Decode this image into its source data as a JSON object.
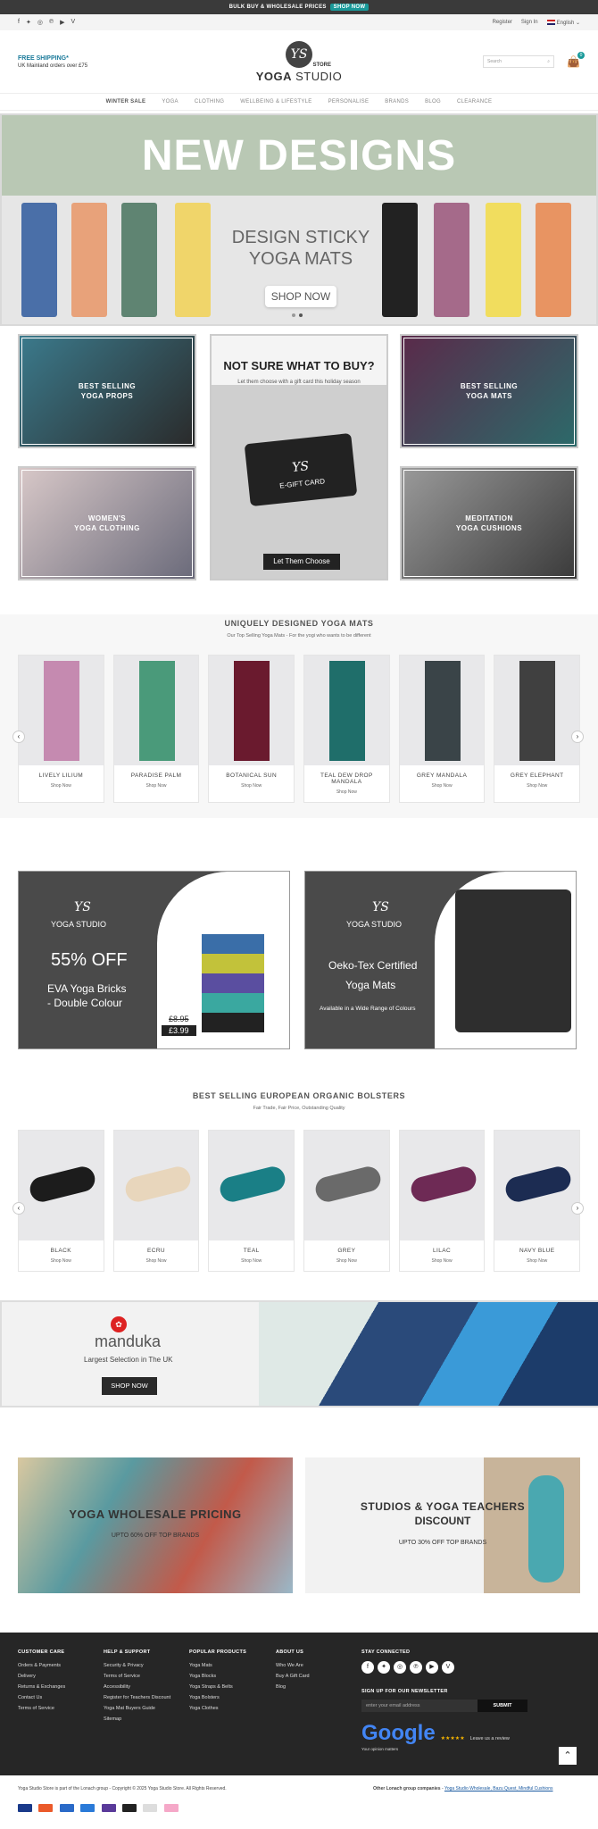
{
  "topbar": {
    "text": "BULK BUY & WHOLESALE PRICES",
    "button": "SHOP NOW"
  },
  "util": {
    "register": "Register",
    "signin": "Sign In",
    "language": "English"
  },
  "header": {
    "freeship_title": "FREE SHIPPING*",
    "freeship_text": "UK Mainland orders over £75",
    "logo_initials": "YS",
    "logo_name": "YOGA",
    "logo_name2": "STUDIO",
    "logo_store": "STORE",
    "search_placeholder": "Search",
    "cart_count": "0"
  },
  "nav": [
    "WINTER SALE",
    "YOGA",
    "CLOTHING",
    "WELLBEING & LIFESTYLE",
    "PERSONALISE",
    "BRANDS",
    "BLOG",
    "CLEARANCE"
  ],
  "hero": {
    "title": "NEW DESIGNS",
    "line1": "DESIGN STICKY",
    "line2": "YOGA MATS",
    "button": "SHOP NOW"
  },
  "tiles": {
    "props": "BEST SELLING\nYOGA PROPS",
    "mats": "BEST SELLING\nYOGA MATS",
    "clothing": "WOMEN'S\nYOGA CLOTHING",
    "cushions": "MEDITATION\nYOGA CUSHIONS"
  },
  "gift": {
    "title": "NOT SURE WHAT TO BUY?",
    "text": "Let them choose with a gift card this holiday season",
    "card_label": "E-GIFT CARD",
    "button": "Let Them Choose"
  },
  "mats_section": {
    "title": "UNIQUELY DESIGNED YOGA MATS",
    "subtitle": "Our Top Selling Yoga Mats - For the yogi who wants to be different",
    "items": [
      {
        "name": "LIVELY LILIUM",
        "shop": "Shop Now",
        "color": "#c58ab0"
      },
      {
        "name": "PARADISE PALM",
        "shop": "Shop Now",
        "color": "#4a9a7a"
      },
      {
        "name": "BOTANICAL SUN",
        "shop": "Shop Now",
        "color": "#6a1a2e"
      },
      {
        "name": "TEAL DEW DROP MANDALA",
        "shop": "Shop Now",
        "color": "#1f6e6a"
      },
      {
        "name": "GREY MANDALA",
        "shop": "Shop Now",
        "color": "#3a4448"
      },
      {
        "name": "GREY ELEPHANT",
        "shop": "Shop Now",
        "color": "#404040"
      }
    ]
  },
  "promo1": {
    "brand": "YOGA STUDIO",
    "headline": "55% OFF",
    "line1": "EVA Yoga Bricks",
    "line2": "- Double Colour",
    "old_price": "£8.95",
    "new_price": "£3.99"
  },
  "promo2": {
    "brand": "YOGA STUDIO",
    "line1": "Oeko-Tex Certified",
    "line2": "Yoga Mats",
    "line3": "Available in a Wide Range of Colours"
  },
  "bolsters": {
    "title": "BEST SELLING EUROPEAN ORGANIC BOLSTERS",
    "subtitle": "Fair Trade, Fair Price, Outstanding Quality",
    "items": [
      {
        "name": "BLACK",
        "shop": "Shop Now",
        "color": "#1c1c1c"
      },
      {
        "name": "ECRU",
        "shop": "Shop Now",
        "color": "#e8d6bc"
      },
      {
        "name": "TEAL",
        "shop": "Shop Now",
        "color": "#1a7f86"
      },
      {
        "name": "GREY",
        "shop": "Shop Now",
        "color": "#6a6a6a"
      },
      {
        "name": "LILAC",
        "shop": "Shop Now",
        "color": "#6e2a55"
      },
      {
        "name": "NAVY BLUE",
        "shop": "Shop Now",
        "color": "#1c2c52"
      }
    ]
  },
  "manduka": {
    "brand": "manduka",
    "text": "Largest Selection in The UK",
    "button": "SHOP NOW"
  },
  "wholesale": {
    "title": "YOGA WHOLESALE PRICING",
    "sub": "UPTO 60% OFF TOP BRANDS"
  },
  "teachers": {
    "title": "STUDIOS & YOGA TEACHERS",
    "title2": "DISCOUNT",
    "sub": "UPTO 30% OFF TOP BRANDS"
  },
  "footer": {
    "col1": {
      "title": "CUSTOMER CARE",
      "links": [
        "Orders & Payments",
        "Delivery",
        "Returns & Exchanges",
        "Contact Us",
        "Terms of Service"
      ]
    },
    "col2": {
      "title": "HELP & SUPPORT",
      "links": [
        "Security & Privacy",
        "Terms of Service",
        "Accessibility",
        "Register for Teachers Discount",
        "Yoga Mat Buyers Guide",
        "Sitemap"
      ]
    },
    "col3": {
      "title": "POPULAR PRODUCTS",
      "links": [
        "Yoga Mats",
        "Yoga Blocks",
        "Yoga Straps & Belts",
        "Yoga Bolsters",
        "Yoga Clothes"
      ]
    },
    "col4": {
      "title": "ABOUT US",
      "links": [
        "Who We Are",
        "Buy A Gift Card",
        "Blog"
      ]
    },
    "stay": "STAY CONNECTED",
    "newsletter": "SIGN UP FOR OUR NEWSLETTER",
    "email_placeholder": "enter your email address",
    "submit": "SUBMIT",
    "google": "Google",
    "google_sub": "Your opinion matters",
    "stars": "★★★★★",
    "review": "Leave us a review"
  },
  "bottom": {
    "copyright": "Yoga Studio Store is part of the Lonach group - Copyright © 2025 Yoga Studio Store. All Rights Reserved.",
    "other": "Other Lonach group companies",
    "links": "Yoga Studio Wholesale, Bazu Quest, Mindful Cushions"
  }
}
